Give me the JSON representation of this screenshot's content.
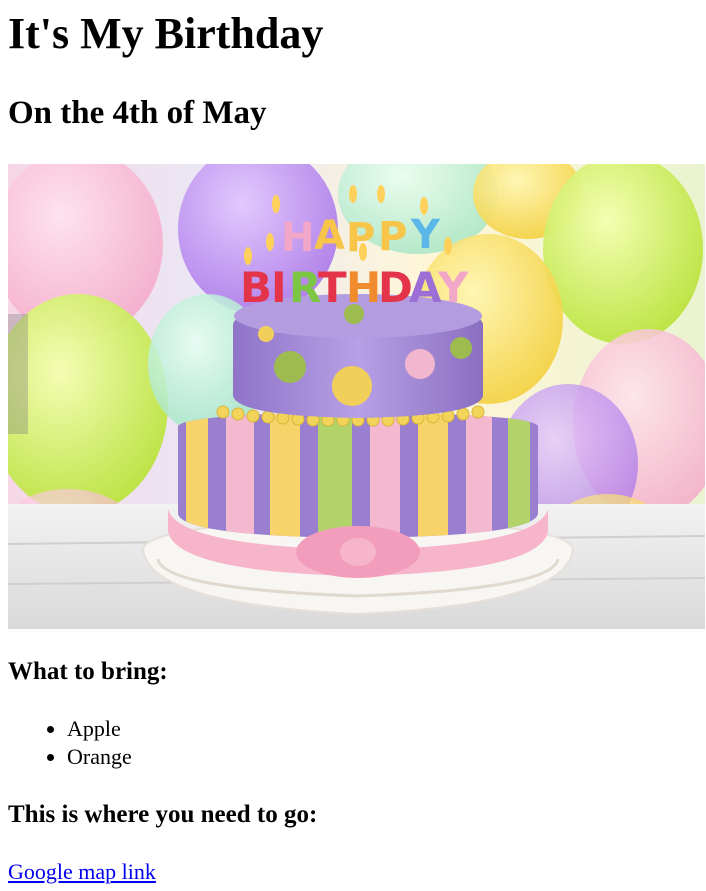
{
  "page": {
    "title": "It's My Birthday",
    "subtitle": "On the 4th of May"
  },
  "hero_image": {
    "subject": "birthday cake with candles spelling HAPPY BIRTHDAY",
    "candle_text_top": "HAPPY",
    "candle_text_bottom": "BIRTHDAY"
  },
  "bring": {
    "heading": "What to bring:",
    "items": [
      "Apple",
      "Orange"
    ]
  },
  "directions": {
    "heading": "This is where you need to go:",
    "link_label": "Google map link"
  },
  "colors": {
    "link": "#0000ee",
    "text": "#000000",
    "background": "#ffffff"
  }
}
